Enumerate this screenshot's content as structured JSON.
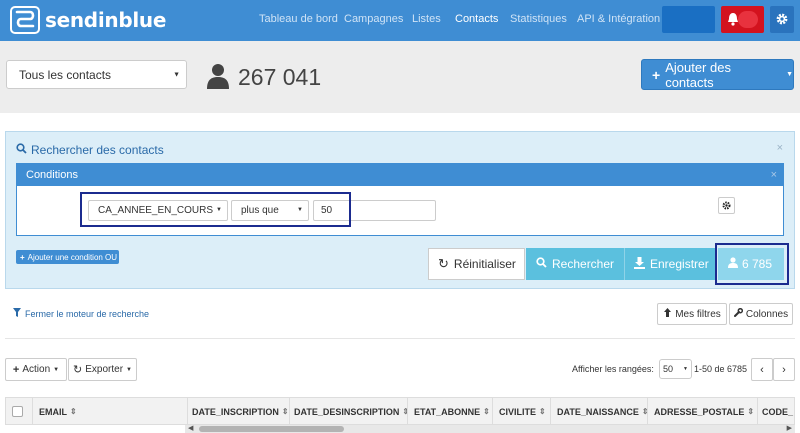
{
  "app": {
    "logo_text": "sendinblue",
    "nav": [
      {
        "label": "Tableau de bord",
        "active": false
      },
      {
        "label": "Campagnes",
        "active": false
      },
      {
        "label": "Listes",
        "active": false
      },
      {
        "label": "Contacts",
        "active": true
      },
      {
        "label": "Statistiques",
        "active": false
      },
      {
        "label": "API & Intégration",
        "active": false
      }
    ]
  },
  "header": {
    "list_select": "Tous les contacts",
    "contact_count": "267 041",
    "add_contacts_label": "Ajouter des contacts"
  },
  "search": {
    "title": "Rechercher des contacts",
    "conditions_title": "Conditions",
    "field_select": "CA_ANNEE_EN_COURS",
    "operator_select": "plus que",
    "value": "50",
    "add_or_condition": "Ajouter une condition OU",
    "reset_label": "Réinitialiser",
    "search_label": "Rechercher",
    "save_label": "Enregistrer",
    "result_count": "6 785",
    "close_symbol": "×"
  },
  "toolbar": {
    "close_engine": "Fermer le moteur de recherche",
    "my_filters": "Mes filtres",
    "columns": "Colonnes",
    "action": "Action",
    "export": "Exporter",
    "rows_label": "Afficher les rangées:",
    "rows_value": "50",
    "range": "1-50 de 6785"
  },
  "table": {
    "columns": [
      "EMAIL",
      "DATE_INSCRIPTION",
      "DATE_DESINSCRIPTION",
      "ETAT_ABONNE",
      "CIVILITE",
      "DATE_NAISSANCE",
      "ADRESSE_POSTALE",
      "CODE_"
    ]
  },
  "colors": {
    "nav_bg": "#3f8dd3",
    "accent": "#5bc0de",
    "highlight_border": "#1b2b8f",
    "panel_bg": "#dceef8"
  }
}
